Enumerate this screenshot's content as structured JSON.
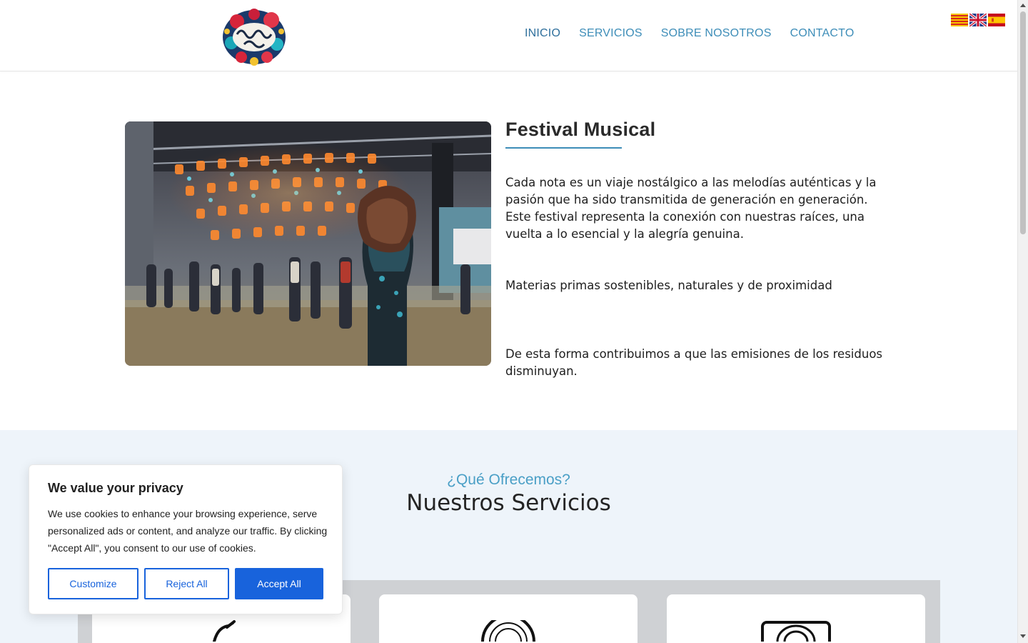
{
  "header": {
    "logo_alt": "Xirimita Folk",
    "nav": [
      {
        "label": "INICIO"
      },
      {
        "label": "SERVICIOS"
      },
      {
        "label": "SOBRE NOSOTROS"
      },
      {
        "label": "CONTACTO"
      }
    ],
    "languages": [
      {
        "code": "ca",
        "icon": "catalan-flag-icon"
      },
      {
        "code": "en",
        "icon": "uk-flag-icon"
      },
      {
        "code": "es",
        "icon": "spanish-flag-icon"
      }
    ],
    "colors": {
      "nav": "#3d8db8"
    }
  },
  "festival": {
    "title": "Festival Musical",
    "paragraphs": [
      "Cada nota es un viaje nostálgico a las melodías auténticas y la pasión que ha sido transmitida de generación en generación. Este festival representa la conexión con nuestras raíces, una vuelta a lo esencial y la alegría genuina.",
      "Materias primas sostenibles, naturales y de proximidad",
      "De esta forma contribuimos a que las emisiones de los residuos disminuyan."
    ]
  },
  "services": {
    "kicker": "¿Qué Ofrecemos?",
    "title": "Nuestros Servicios",
    "cards": [
      {
        "icon": "guitar-icon"
      },
      {
        "icon": "vinyl-record-icon"
      },
      {
        "icon": "speaker-icon"
      }
    ]
  },
  "cookie": {
    "title": "We value your privacy",
    "text": "We use cookies to enhance your browsing experience, serve personalized ads or content, and analyze our traffic. By clicking \"Accept All\", you consent to our use of cookies.",
    "buttons": {
      "customize": "Customize",
      "reject": "Reject All",
      "accept": "Accept All"
    },
    "colors": {
      "accent": "#1863dc"
    }
  }
}
